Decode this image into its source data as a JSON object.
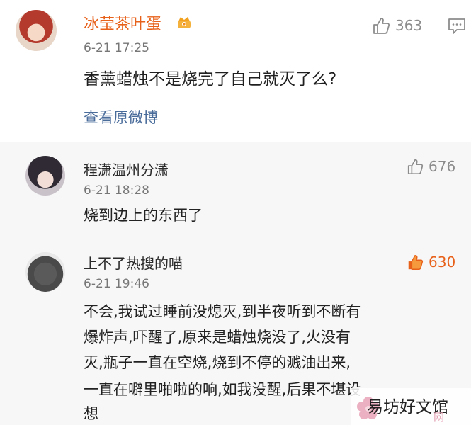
{
  "post": {
    "author": "冰莹茶叶蛋",
    "time": "6-21 17:25",
    "text": "香薰蜡烛不是烧完了自己就灭了么?",
    "view_original": "查看原微博",
    "likes": "363"
  },
  "comments": [
    {
      "author": "程潇温州分潇",
      "time": "6-21 18:28",
      "text": "烧到边上的东西了",
      "likes": "676"
    },
    {
      "author": "上不了热搜的喵",
      "time": "6-21 19:46",
      "lines": [
        "不会,我试过睡前没熄灭,到半夜听到不断有",
        "爆炸声,吓醒了,原来是蜡烛烧没了,火没有",
        "灭,瓶子一直在空烧,烧到不停的溅油出来,",
        "一直在噼里啪啦的响,如我没醒,后果不堪设",
        "想"
      ],
      "likes": "630"
    }
  ],
  "watermark": {
    "text": "易坊好文馆",
    "sub": "网"
  },
  "icons": {
    "like": "thumbs-up-icon",
    "comment": "comment-icon",
    "badge": "crown-badge-icon",
    "watermark": "flower-logo-icon"
  },
  "colors": {
    "author_orange": "#e8611a",
    "link_blue": "#4a6c9b",
    "liked_orange": "#e8611a",
    "comments_bg": "#f7f7f7"
  }
}
